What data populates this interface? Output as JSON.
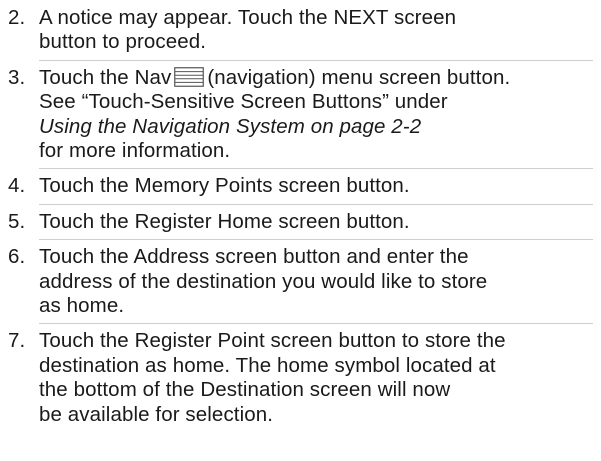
{
  "steps": [
    {
      "number": "2.",
      "lines": [
        "A notice may appear. Touch the NEXT screen",
        "button to proceed."
      ]
    },
    {
      "number": "3.",
      "line1_before_icon": "Touch the Nav",
      "icon": "list-menu-icon",
      "line1_after_icon": "(navigation) menu screen button.",
      "line2": "See “Touch-Sensitive Screen Buttons” under",
      "line3_italic": "Using the Navigation System on page 2-2",
      "line4": "for more information."
    },
    {
      "number": "4.",
      "lines": [
        "Touch the Memory Points screen button."
      ]
    },
    {
      "number": "5.",
      "lines": [
        "Touch the Register Home screen button."
      ]
    },
    {
      "number": "6.",
      "lines": [
        "Touch the Address screen button and enter the",
        "address of the destination you would like to store",
        "as home."
      ]
    },
    {
      "number": "7.",
      "lines": [
        "Touch the Register Point screen button to store the",
        "destination as home. The home symbol located at",
        "the bottom of the Destination screen will now",
        "be available for selection."
      ]
    }
  ]
}
